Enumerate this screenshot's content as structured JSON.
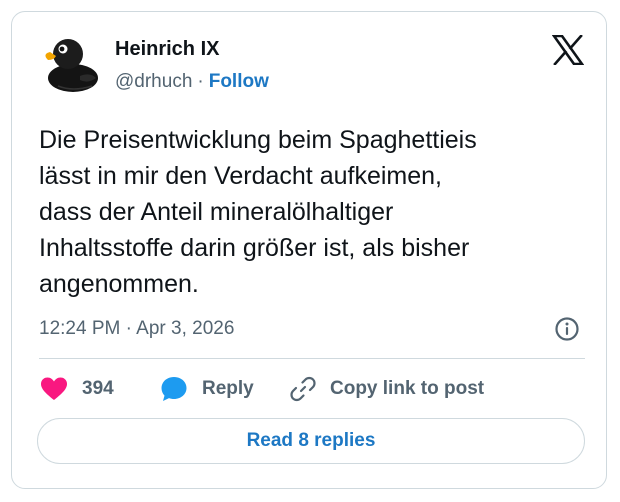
{
  "author": {
    "name": "Heinrich IX",
    "handle": "@drhuch",
    "separator": "·",
    "follow_label": "Follow",
    "avatar_icon": "rubber-duck-avatar"
  },
  "brand": {
    "logo_icon": "x-logo-icon"
  },
  "tweet": {
    "text": "Die Preisentwicklung beim Spaghettieis\nlässt in mir den Verdacht aufkeimen,\ndass der Anteil mineralölhaltiger\nInhaltsstoffe darin größer ist, als bisher\nangenommen.",
    "timestamp": "12:24 PM · Apr 3, 2026",
    "info_icon": "info-icon"
  },
  "actions": {
    "like_count": "394",
    "like_icon": "heart-icon",
    "reply_label": "Reply",
    "reply_icon": "speech-bubble-icon",
    "copy_label": "Copy link to post",
    "copy_icon": "link-icon"
  },
  "footer": {
    "read_replies_label": "Read 8 replies"
  },
  "colors": {
    "accent": "#1d78c4",
    "like": "#f91880",
    "reply": "#1d9bf0",
    "muted_text": "#536471",
    "border": "#cfd9de"
  }
}
